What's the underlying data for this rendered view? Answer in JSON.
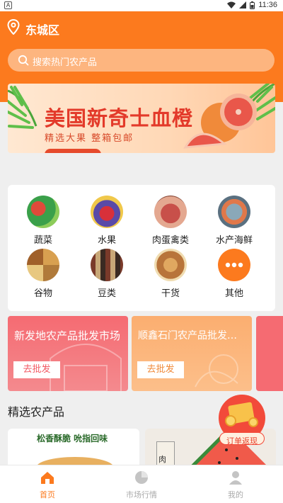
{
  "status_bar": {
    "time": "11:36",
    "app_indicator": "A"
  },
  "header": {
    "location": "东城区",
    "search_placeholder": "搜索热门农产品"
  },
  "banner": {
    "title": "美国新奇士血橙",
    "subtitle": "精选大果  整箱包邮"
  },
  "categories": [
    {
      "label": "蔬菜",
      "icon": "vegetables-icon"
    },
    {
      "label": "水果",
      "icon": "fruits-icon"
    },
    {
      "label": "肉蛋禽类",
      "icon": "meat-egg-icon"
    },
    {
      "label": "水产海鲜",
      "icon": "seafood-icon"
    },
    {
      "label": "谷物",
      "icon": "grains-icon"
    },
    {
      "label": "豆类",
      "icon": "beans-icon"
    },
    {
      "label": "干货",
      "icon": "dried-goods-icon"
    },
    {
      "label": "其他",
      "icon": "more-icon"
    }
  ],
  "markets": [
    {
      "name": "新发地农产品批发市场",
      "button": "去批发"
    },
    {
      "name": "顺鑫石门农产品批发…",
      "button": "去批发"
    }
  ],
  "featured": {
    "title": "精选农产品",
    "product1": {
      "headline": "松香酥脆 吮指回味"
    },
    "product2": {
      "label": "肉"
    }
  },
  "float_badge": {
    "label": "订单返现"
  },
  "tabbar": {
    "items": [
      {
        "label": "首页",
        "active": true
      },
      {
        "label": "市场行情",
        "active": false
      },
      {
        "label": "我的",
        "active": false
      }
    ]
  },
  "colors": {
    "primary": "#fc7a1e",
    "accent_red": "#e33a2a",
    "tab_active": "#fc7a1e",
    "tab_inactive": "#bbbbbb"
  }
}
